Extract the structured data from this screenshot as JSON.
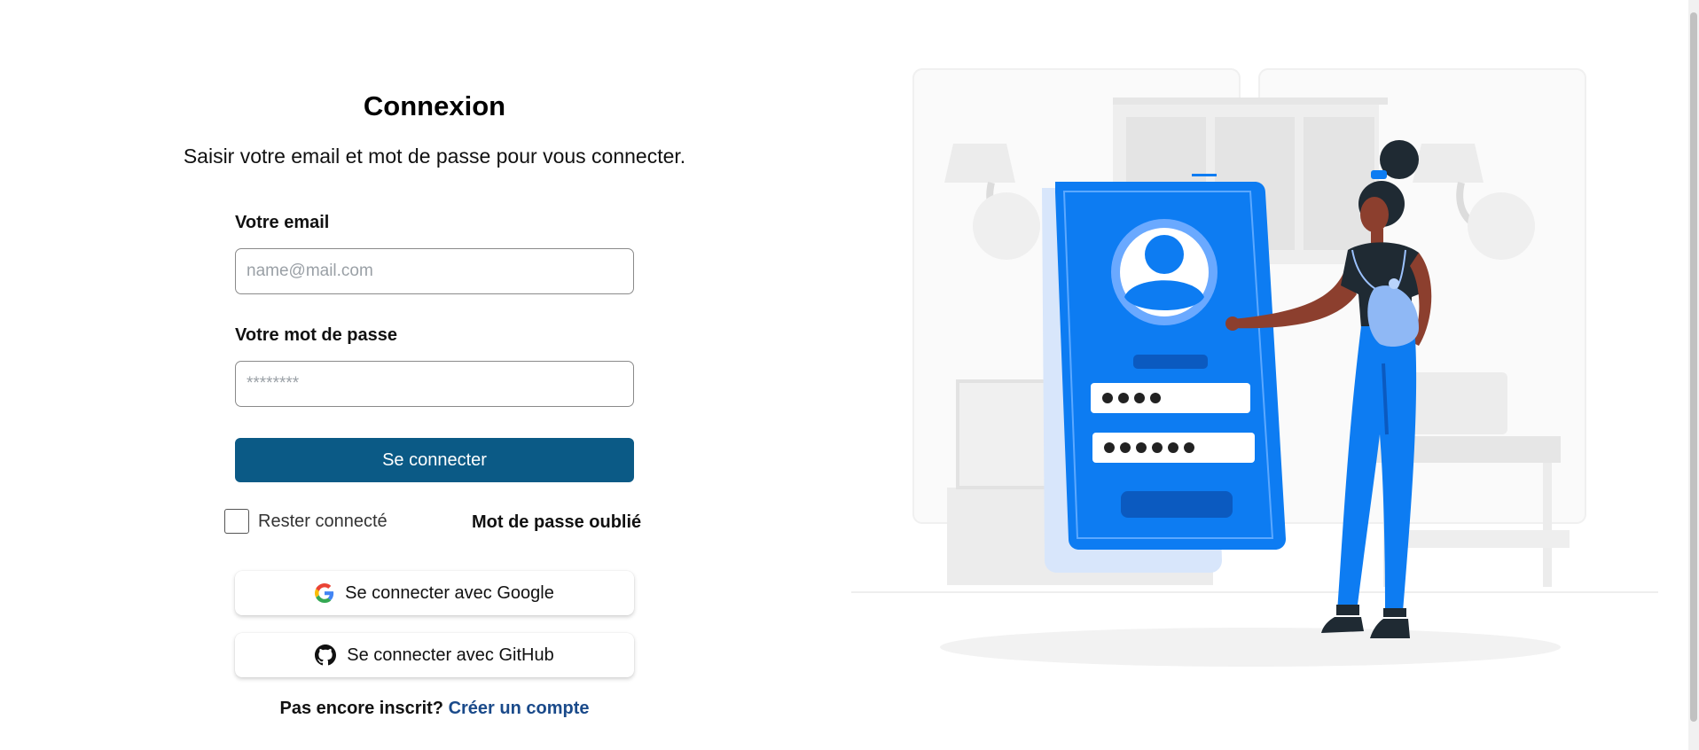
{
  "login": {
    "title": "Connexion",
    "subtitle": "Saisir votre email et mot de passe pour vous connecter.",
    "email": {
      "label": "Votre email",
      "placeholder": "name@mail.com",
      "value": ""
    },
    "password": {
      "label": "Votre mot de passe",
      "placeholder": "********",
      "value": ""
    },
    "submit_label": "Se connecter",
    "remember_label": "Rester connecté",
    "remember_checked": false,
    "forgot_label": "Mot de passe oublié",
    "google_label": "Se connecter avec Google",
    "github_label": "Se connecter avec GitHub",
    "signup_question": "Pas encore inscrit?",
    "signup_link": "Créer un compte"
  },
  "icons": {
    "google": "google-icon",
    "github": "github-icon"
  },
  "colors": {
    "primary_button": "#0b5a86",
    "illustration_blue": "#0d7cf2",
    "link": "#1a4a8a"
  }
}
